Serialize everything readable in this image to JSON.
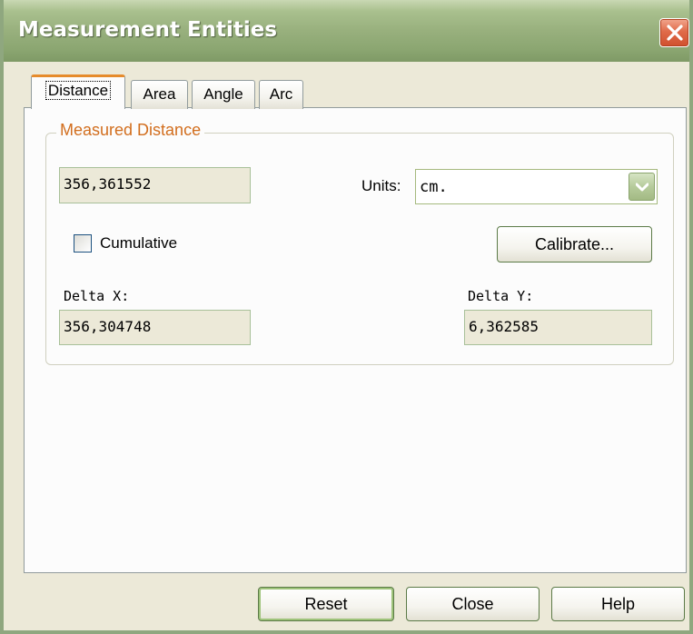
{
  "window": {
    "title": "Measurement Entities"
  },
  "tabs": [
    {
      "label": "Distance",
      "active": true
    },
    {
      "label": "Area",
      "active": false
    },
    {
      "label": "Angle",
      "active": false
    },
    {
      "label": "Arc",
      "active": false
    }
  ],
  "group": {
    "legend": "Measured Distance",
    "measured_value": "356,361552",
    "units_label": "Units:",
    "units_value": "cm.",
    "cumulative_label": "Cumulative",
    "cumulative_checked": false,
    "calibrate_label": "Calibrate...",
    "delta_x_label": "Delta X:",
    "delta_x_value": "356,304748",
    "delta_y_label": "Delta Y:",
    "delta_y_value": "6,362585"
  },
  "buttons": {
    "reset": "Reset",
    "close": "Close",
    "help": "Help"
  },
  "icons": {
    "close": "close-icon",
    "dropdown": "chevron-down-icon"
  },
  "colors": {
    "titlebar": "#98b07d",
    "accent_tab": "#e68b2c",
    "legend_text": "#d26e1e",
    "close_button": "#e06b4a",
    "window_bg": "#ece9d8"
  }
}
